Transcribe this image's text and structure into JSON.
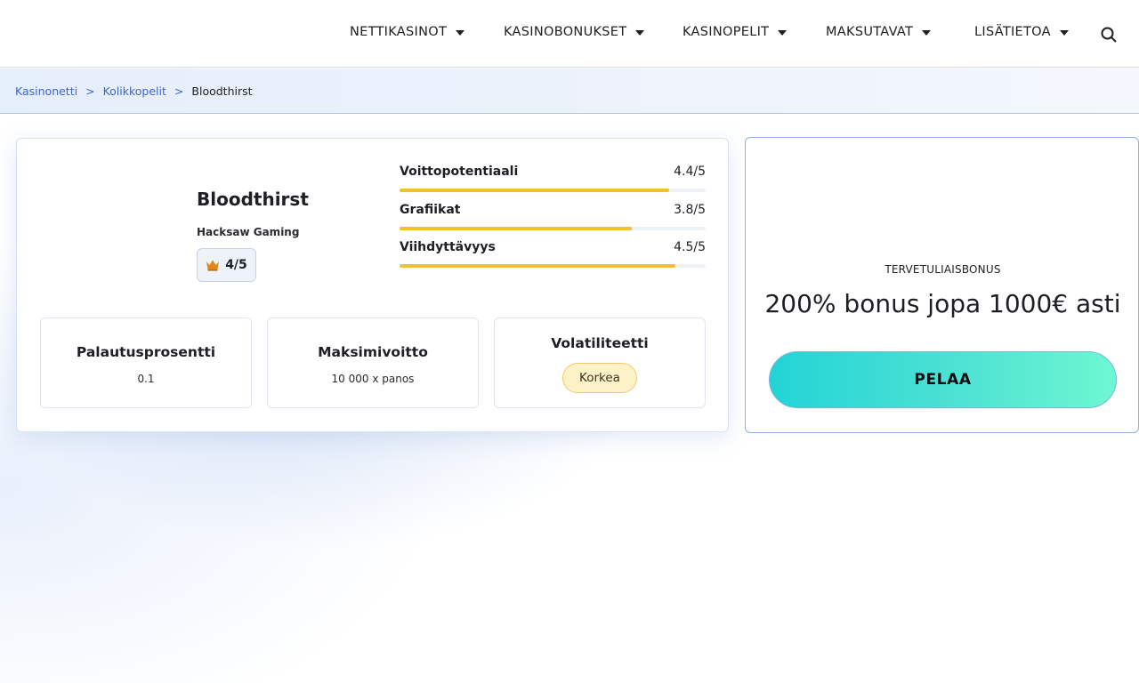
{
  "nav": {
    "items": [
      {
        "label": "NETTIKASINOT"
      },
      {
        "label": "KASINOBONUKSET"
      },
      {
        "label": "KASINOPELIT"
      },
      {
        "label": "MAKSUTAVAT"
      },
      {
        "label": "LISÄTIETOA"
      }
    ],
    "search_icon": "search-icon"
  },
  "breadcrumb": {
    "items": [
      "Kasinonetti",
      "Kolikkopelit"
    ],
    "separator": ">",
    "current": "Bloodthirst"
  },
  "game": {
    "title": "Bloodthirst",
    "provider": "Hacksaw Gaming",
    "rating": "4/5",
    "rating_icon": "crown-icon",
    "metrics": [
      {
        "label": "Voittopotentiaali",
        "value": "4.4/5",
        "score": 4.4
      },
      {
        "label": "Grafiikat",
        "value": "3.8/5",
        "score": 3.8
      },
      {
        "label": "Viihdyttävyys",
        "value": "4.5/5",
        "score": 4.5
      }
    ],
    "stats": [
      {
        "title": "Palautusprosentti",
        "value": "0.1"
      },
      {
        "title": "Maksimivoitto",
        "value": "10 000 x panos"
      },
      {
        "title": "Volatiliteetti",
        "value": "Korkea"
      }
    ],
    "bar_color": "#f6bf2f"
  },
  "bonus": {
    "label": "TERVETULIAISBONUS",
    "text": "200% bonus jopa 1000€ asti",
    "button": "PELAA"
  }
}
